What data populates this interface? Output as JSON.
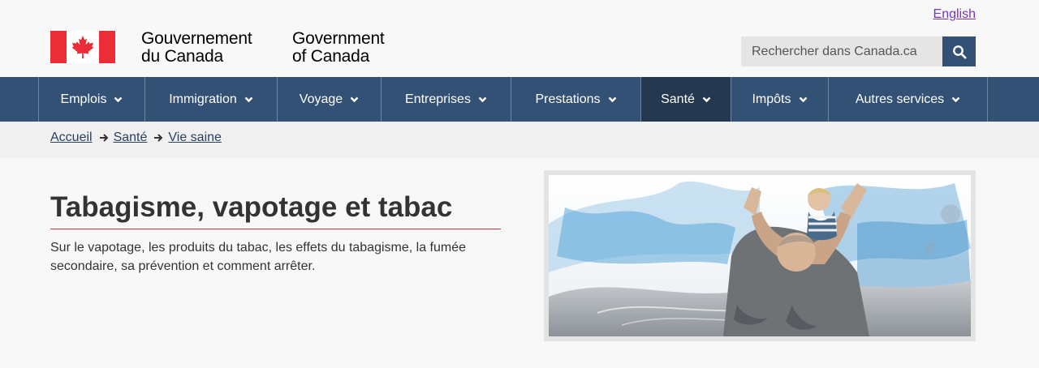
{
  "header": {
    "language_link": "English",
    "wordmark_fr": [
      "Gouvernement",
      "du Canada"
    ],
    "wordmark_en": [
      "Government",
      "of Canada"
    ]
  },
  "search": {
    "placeholder": "Rechercher dans Canada.ca"
  },
  "nav": {
    "items": [
      {
        "label": "Emplois"
      },
      {
        "label": "Immigration"
      },
      {
        "label": "Voyage"
      },
      {
        "label": "Entreprises"
      },
      {
        "label": "Prestations"
      },
      {
        "label": "Santé"
      },
      {
        "label": "Impôts"
      },
      {
        "label": "Autres services"
      }
    ]
  },
  "breadcrumb": [
    "Accueil",
    "Santé",
    "Vie saine"
  ],
  "main": {
    "title": "Tabagisme, vapotage et tabac",
    "description": "Sur le vapotage, les produits du tabac, les effets du tabagisme, la fumée secondaire, sa prévention et comment arrêter."
  },
  "colors": {
    "nav_bg": "#335075",
    "nav_active": "#243850",
    "flag_red": "#eb2d37",
    "title_rule": "#af3c43",
    "link_visited": "#7834bc"
  },
  "icons": {
    "search": "magnifier-icon",
    "caret": "chevron-down-icon",
    "breadcrumb_separator": "arrow-right-icon",
    "flag": "maple-leaf-icon"
  }
}
